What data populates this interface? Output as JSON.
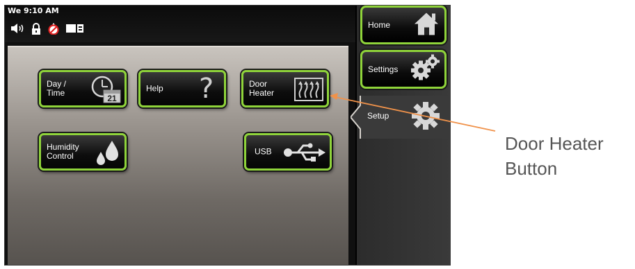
{
  "status_bar": {
    "time": "We 9:10 AM",
    "icons": [
      "speaker-icon",
      "lock-icon",
      "no-water-icon",
      "battery-icon"
    ]
  },
  "buttons": {
    "day_time": {
      "label": "Day /\nTime",
      "icon": "clock-calendar-icon",
      "calendar_day": "21"
    },
    "help": {
      "label": "Help",
      "icon": "question-mark-icon",
      "glyph": "?"
    },
    "door_heater": {
      "label": "Door\nHeater",
      "icon": "heater-icon"
    },
    "humidity_control": {
      "label": "Humidity\nControl",
      "icon": "water-drops-icon"
    },
    "usb": {
      "label": "USB",
      "icon": "usb-icon"
    }
  },
  "nav": {
    "home": {
      "label": "Home",
      "icon": "house-icon"
    },
    "settings": {
      "label": "Settings",
      "icon": "gears-icon"
    },
    "setup": {
      "label": "Setup",
      "icon": "gear-icon",
      "active": true
    }
  },
  "callout": {
    "text": "Door Heater\nButton",
    "color": "#f0924a"
  },
  "colors": {
    "button_border": "#8fd43a",
    "accent_orange": "#f0924a"
  }
}
